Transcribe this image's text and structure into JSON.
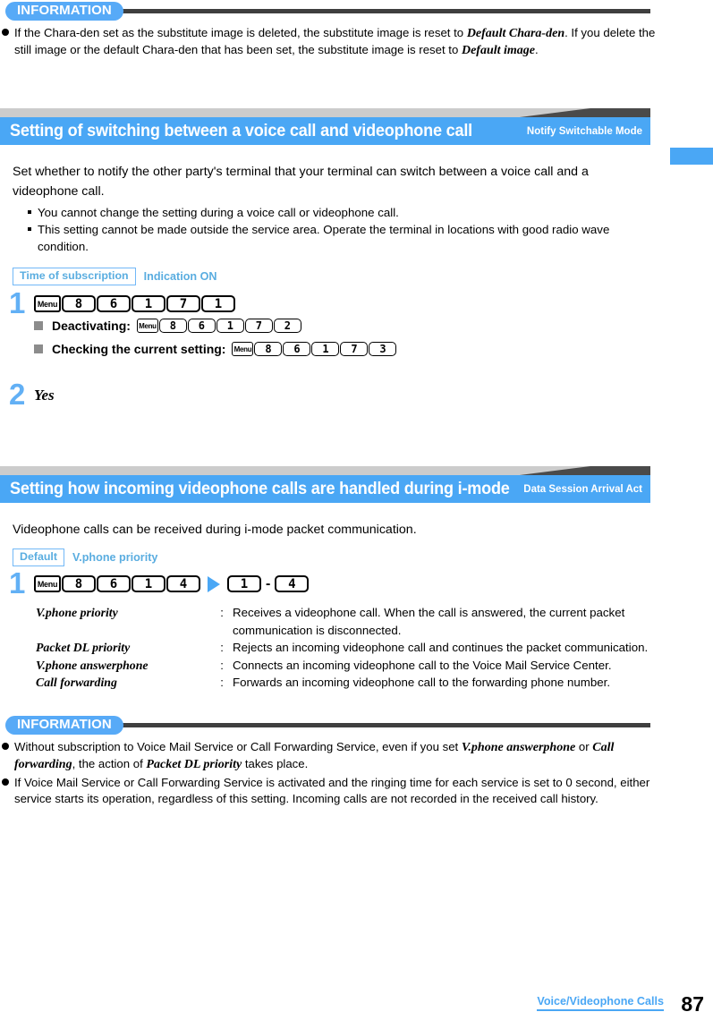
{
  "info_top": {
    "badge": "INFORMATION",
    "items": [
      {
        "parts": [
          {
            "t": "If the Chara-den set as the substitute image is deleted, the substitute image is reset to ",
            "s": "normal"
          },
          {
            "t": "Default Chara-den",
            "s": "em"
          },
          {
            "t": ". If you delete the still image or the default Chara-den that has been set, the substitute image is reset to ",
            "s": "normal"
          },
          {
            "t": "Default image",
            "s": "em"
          },
          {
            "t": ".",
            "s": "normal"
          }
        ]
      }
    ]
  },
  "section1": {
    "title": "Setting of switching between a voice call and videophone call",
    "subtitle": "Notify Switchable Mode",
    "intro": "Set whether to notify the other party's terminal that your terminal can switch between a voice call and a videophone call.",
    "bullets": [
      "You cannot change the setting during a voice call or videophone call.",
      "This setting cannot be made outside the service area. Operate the terminal in locations with good radio wave condition."
    ],
    "tag_label": "Time of subscription",
    "tag_value": "Indication ON",
    "step1": {
      "number": "1",
      "keys": [
        "Menu",
        "8",
        "6",
        "1",
        "7",
        "1"
      ],
      "subitems": [
        {
          "label": "Deactivating:",
          "keys": [
            "Menu",
            "8",
            "6",
            "1",
            "7",
            "2"
          ]
        },
        {
          "label": "Checking the current setting:",
          "keys": [
            "Menu",
            "8",
            "6",
            "1",
            "7",
            "3"
          ]
        }
      ]
    },
    "step2": {
      "number": "2",
      "value": "Yes"
    }
  },
  "section2": {
    "title": "Setting how incoming videophone calls are handled during i-mode",
    "subtitle": "Data Session Arrival Act",
    "intro": "Videophone calls can be received during i-mode packet communication.",
    "tag_label": "Default",
    "tag_value": "V.phone priority",
    "step1": {
      "number": "1",
      "keys": [
        "Menu",
        "8",
        "6",
        "1",
        "4"
      ],
      "arrow": "▶",
      "range_from": "1",
      "range_dash": "-",
      "range_to": "4"
    },
    "options": [
      {
        "term": "V.phone priority",
        "colon": ":",
        "desc": "Receives a videophone call. When the call is answered, the current packet communication is disconnected."
      },
      {
        "term": "Packet DL priority",
        "colon": ":",
        "desc": "Rejects an incoming videophone call and continues the packet communication."
      },
      {
        "term": "V.phone answerphone",
        "colon": ":",
        "desc": "Connects an incoming videophone call to the Voice Mail Service Center."
      },
      {
        "term": "Call forwarding",
        "colon": ":",
        "desc": "Forwards an incoming videophone call to the forwarding phone number."
      }
    ]
  },
  "info_bottom": {
    "badge": "INFORMATION",
    "items": [
      {
        "parts": [
          {
            "t": "Without subscription to Voice Mail Service or Call Forwarding Service, even if you set ",
            "s": "normal"
          },
          {
            "t": "V.phone answerphone",
            "s": "em"
          },
          {
            "t": " or ",
            "s": "normal"
          },
          {
            "t": "Call forwarding",
            "s": "em"
          },
          {
            "t": ", the action of ",
            "s": "normal"
          },
          {
            "t": "Packet DL priority",
            "s": "em"
          },
          {
            "t": " takes place.",
            "s": "normal"
          }
        ]
      },
      {
        "parts": [
          {
            "t": "If Voice Mail Service or Call Forwarding Service is activated and the ringing time for each service is set to 0 second, either service starts its operation, regardless of this setting. Incoming calls are not recorded in the received call history.",
            "s": "normal"
          }
        ]
      }
    ]
  },
  "footer": {
    "chapter": "Voice/Videophone Calls",
    "page": "87"
  },
  "colors": {
    "accent_blue": "#4aa7f5",
    "badge_blue": "#57aaf7",
    "tag_blue": "#5aade0",
    "rule_dark": "#3f3f3f",
    "bar_dark": "#4a4a4a",
    "bar_light": "#cccccc",
    "gray_square": "#8c8c8c"
  }
}
